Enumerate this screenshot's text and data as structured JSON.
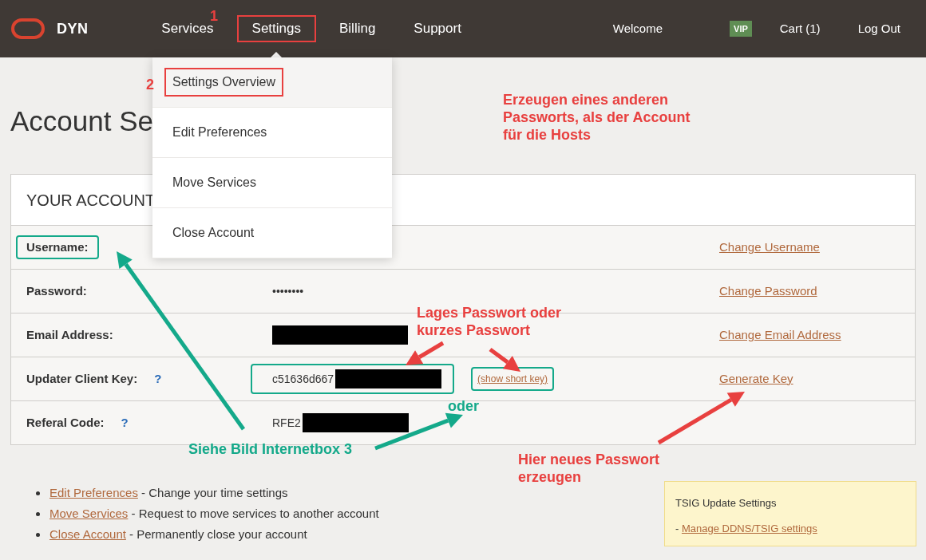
{
  "header": {
    "logo_text": "DYN",
    "nav": [
      {
        "label": "Services",
        "selected": false,
        "boxed": false
      },
      {
        "label": "Settings",
        "selected": true,
        "boxed": true
      },
      {
        "label": "Billing",
        "selected": false,
        "boxed": false
      },
      {
        "label": "Support",
        "selected": false,
        "boxed": false
      }
    ],
    "welcome": "Welcome",
    "badge": "VIP",
    "cart": "Cart (1)",
    "logout": "Log Out"
  },
  "settings_menu": {
    "items": [
      {
        "label": "Settings Overview",
        "selected": true,
        "boxed": true
      },
      {
        "label": "Edit Preferences",
        "selected": false,
        "boxed": false
      },
      {
        "label": "Move Services",
        "selected": false,
        "boxed": false
      },
      {
        "label": "Close Account",
        "selected": false,
        "boxed": false
      }
    ]
  },
  "page_title": "Account Se",
  "account_card": {
    "title": "YOUR ACCOUNT",
    "rows": [
      {
        "label": "Username:",
        "boxed": true,
        "redacted": false,
        "link": "Change Username"
      },
      {
        "label": "Password:",
        "boxed": false,
        "value": "••••••••",
        "redacted": false,
        "link": "Change Password"
      },
      {
        "label": "Email Address:",
        "boxed": false,
        "redacted": true,
        "link": "Change Email Address"
      },
      {
        "label": "Updater Client Key:",
        "help": "?",
        "boxed": false,
        "value": "c51636d667",
        "value_boxed": true,
        "redacted": true,
        "extra_link": "(show short key)",
        "extra_boxed": true,
        "link": "Generate Key"
      },
      {
        "label": "Referal Code:",
        "help": "?",
        "boxed": false,
        "value": "RFE2",
        "redacted": true
      }
    ]
  },
  "links": [
    {
      "link": "Edit Preferences",
      "text": " - Change your time settings"
    },
    {
      "link": "Move Services",
      "text": " - Request to move services to another account"
    },
    {
      "link": "Close Account",
      "text": " - Permanently close your account"
    }
  ],
  "tsig_box": {
    "title": "TSIG Update Settings",
    "prefix": "- ",
    "link": "Manage DDNS/TSIG settings"
  },
  "annotations": [
    {
      "color": "#e8403f",
      "lines": [
        "1"
      ]
    },
    {
      "color": "#e8403f",
      "lines": [
        "2"
      ]
    },
    {
      "color": "#e8403f",
      "lines": [
        "Erzeugen eines anderen",
        "Passworts, als der Account",
        "für die Hosts"
      ]
    },
    {
      "color": "#e8403f",
      "lines": [
        "Lages Passwort oder",
        "kurzes Passwort"
      ]
    },
    {
      "color": "#14a98a",
      "lines": [
        "oder"
      ]
    },
    {
      "color": "#14a98a",
      "lines": [
        "Siehe Bild Internetbox 3"
      ]
    },
    {
      "color": "#e8403f",
      "lines": [
        "Hier neues Passwort",
        "erzeugen"
      ]
    }
  ]
}
